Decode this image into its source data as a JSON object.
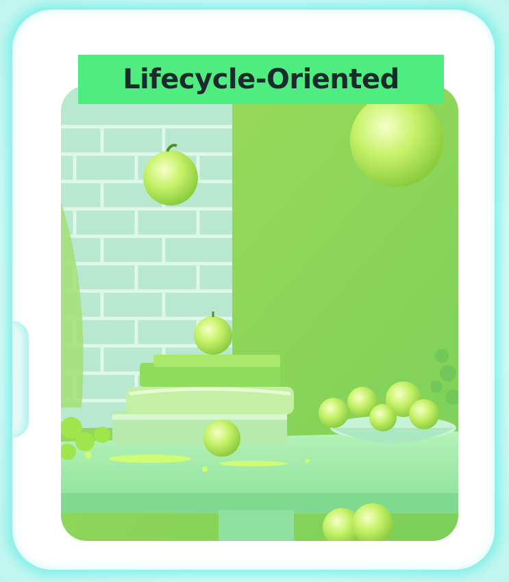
{
  "card": {
    "label": "Lifecycle-Oriented",
    "image_alt": "green apples on stacked books and a bowl on a table in a green room"
  },
  "colors": {
    "label_background": "#4fec80",
    "label_text": "#1b2a2c",
    "card_glow": "#62ece4",
    "card_background": "#ffffff"
  }
}
